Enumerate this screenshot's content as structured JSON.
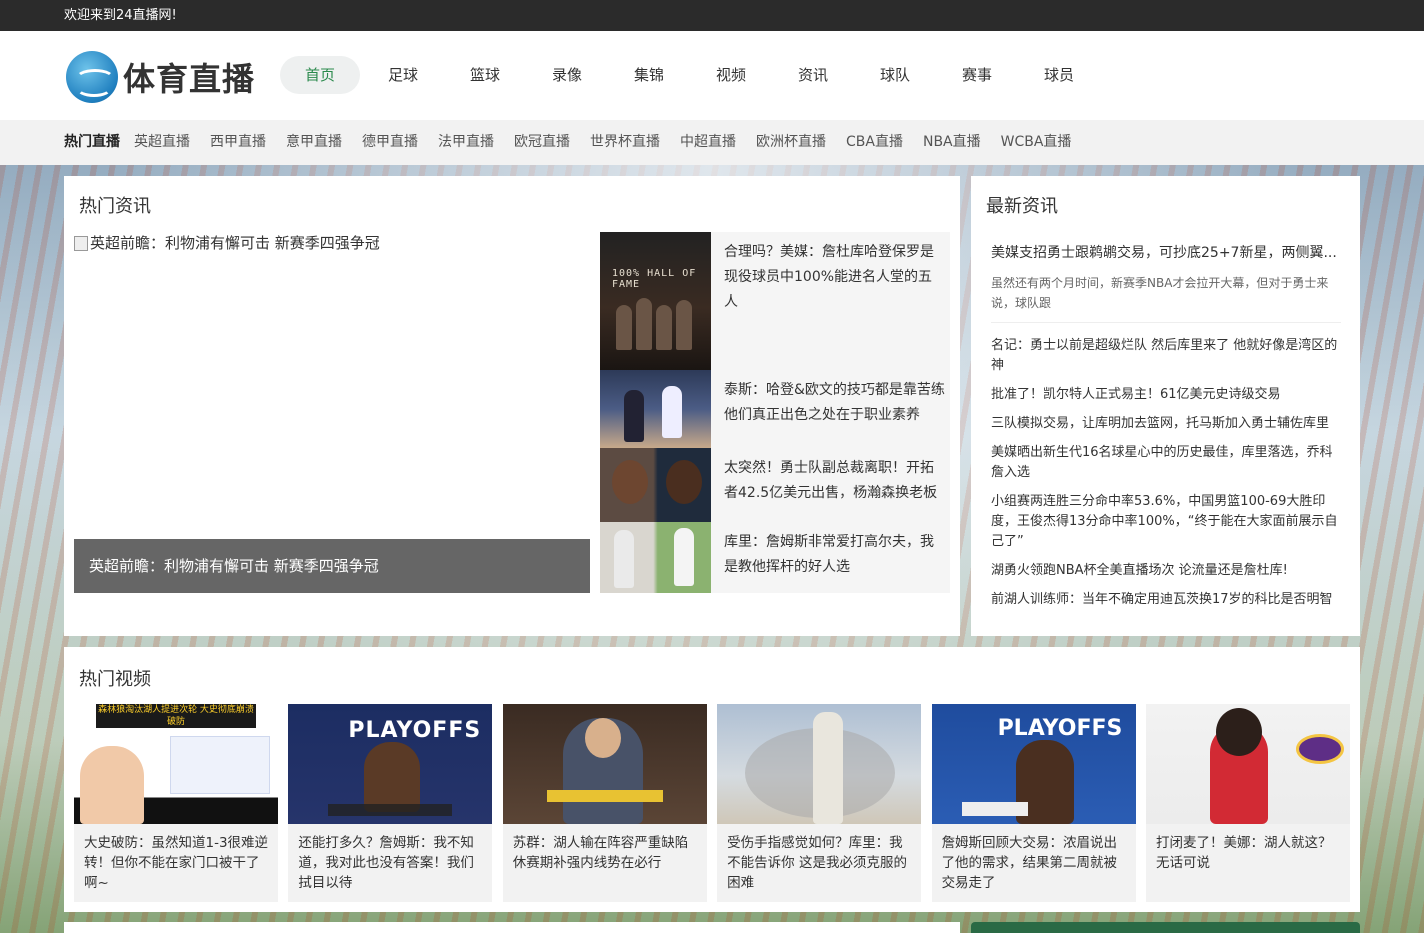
{
  "topbar": {
    "welcome": "欢迎来到24直播网!"
  },
  "header": {
    "logo_text": "体育直播",
    "nav": [
      "首页",
      "足球",
      "篮球",
      "录像",
      "集锦",
      "视频",
      "资讯",
      "球队",
      "赛事",
      "球员"
    ]
  },
  "hotbar": {
    "label": "热门直播",
    "links": [
      "英超直播",
      "西甲直播",
      "意甲直播",
      "德甲直播",
      "法甲直播",
      "欧冠直播",
      "世界杯直播",
      "中超直播",
      "欧洲杯直播",
      "CBA直播",
      "NBA直播",
      "WCBA直播"
    ]
  },
  "hot_news": {
    "title": "热门资讯",
    "featured": {
      "alt": "英超前瞻：利物浦有懈可击 新赛季四强争冠",
      "caption": "英超前瞻：利物浦有懈可击 新赛季四强争冠"
    },
    "items": [
      {
        "text": "合理吗？美媒：詹杜库哈登保罗是现役球员中100%能进名人堂的五人",
        "thumb_label": "100% HALL OF FAME",
        "thumb_icon": "hall-of-fame-poster"
      },
      {
        "text": "泰斯：哈登&欧文的技巧都是靠苦练 他们真正出色之处在于职业素养",
        "thumb_icon": "basketball-court-photo"
      },
      {
        "text": "太突然！勇士队副总裁离职！开拓者42.5亿美元出售，杨瀚森换老板",
        "thumb_icon": "two-players-photo"
      },
      {
        "text": "库里：詹姆斯非常爱打高尔夫，我是教他挥杆的好人选",
        "thumb_icon": "golf-photo"
      }
    ]
  },
  "latest_news": {
    "title": "最新资讯",
    "headline": "美媒支招勇士跟鹈鹕交易，可抄底25+7新星，两侧翼...",
    "summary": "虽然还有两个月时间，新赛季NBA才会拉开大幕，但对于勇士来说，球队跟",
    "items": [
      "名记：勇士以前是超级烂队 然后库里来了 他就好像是湾区的神",
      "批准了！凯尔特人正式易主！61亿美元史诗级交易",
      "三队模拟交易，让库明加去篮网，托马斯加入勇士辅佐库里",
      "美媒晒出新生代16名球星心中的历史最佳，库里落选，乔科詹入选",
      "小组赛两连胜三分命中率53.6%，中国男篮100-69大胜印度，王俊杰得13分命中率100%，“终于能在大家面前展示自己了”",
      "湖勇火领跑NBA杯全美直播场次 论流量还是詹杜库!",
      "前湖人训练师：当年不确定用迪瓦茨换17岁的科比是否明智"
    ]
  },
  "hot_videos": {
    "title": "热门视频",
    "items": [
      {
        "text": "大史破防：虽然知道1-3很难逆转！但你不能在家门口被干了啊~",
        "thumb_label": "森林狼淘汰湖人提进次轮 大史彻底崩溃破防"
      },
      {
        "text": "还能打多久？詹姆斯：我不知道，我对此也没有答案！我们拭目以待",
        "thumb_label": "PLAYOFFS"
      },
      {
        "text": "苏群：湖人输在阵容严重缺陷 休赛期补强内线势在必行",
        "thumb_label": ""
      },
      {
        "text": "受伤手指感觉如何？库里：我不能告诉你 这是我必须克服的困难",
        "thumb_label": ""
      },
      {
        "text": "詹姆斯回顾大交易：浓眉说出了他的需求，结果第二周就被交易走了",
        "thumb_label": "PLAYOFFS"
      },
      {
        "text": "打闭麦了！美娜：湖人就这？无话可说",
        "thumb_label": ""
      }
    ]
  }
}
